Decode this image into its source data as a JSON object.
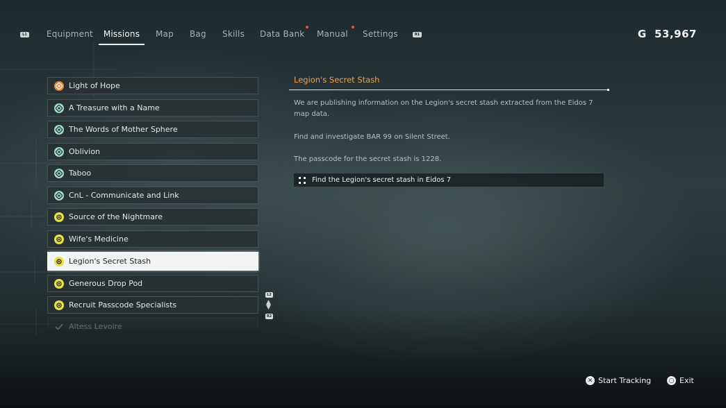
{
  "header": {
    "left_bumper": "L1",
    "right_bumper": "R1",
    "tabs": [
      {
        "label": "Equipment"
      },
      {
        "label": "Missions"
      },
      {
        "label": "Map"
      },
      {
        "label": "Bag"
      },
      {
        "label": "Skills"
      },
      {
        "label": "Data Bank"
      },
      {
        "label": "Manual"
      },
      {
        "label": "Settings"
      }
    ],
    "active_tab": "Missions",
    "notification_color": "#e0553c",
    "currency_symbol": "G",
    "currency_amount": "53,967"
  },
  "missions": {
    "items": [
      {
        "label": "Light of Hope",
        "icon": "main-mission-icon"
      },
      {
        "label": "A Treasure with a Name",
        "icon": "side-mission-icon"
      },
      {
        "label": "The Words of Mother Sphere",
        "icon": "side-mission-icon"
      },
      {
        "label": "Oblivion",
        "icon": "side-mission-icon"
      },
      {
        "label": "Taboo",
        "icon": "side-mission-icon"
      },
      {
        "label": "CnL - Communicate and Link",
        "icon": "side-mission-icon"
      },
      {
        "label": "Source of the Nightmare",
        "icon": "request-mission-icon"
      },
      {
        "label": "Wife's Medicine",
        "icon": "request-mission-icon"
      },
      {
        "label": "Legion's Secret Stash",
        "icon": "request-mission-icon"
      },
      {
        "label": "Generous Drop Pod",
        "icon": "request-mission-icon"
      },
      {
        "label": "Recruit Passcode Specialists",
        "icon": "request-mission-icon"
      },
      {
        "label": "Altess Levoire",
        "icon": "completed-check-icon"
      }
    ],
    "selected": "Legion's Secret Stash",
    "scroll_up_button": "L2",
    "scroll_down_button": "R2"
  },
  "detail": {
    "title": "Legion's Secret Stash",
    "paragraphs": [
      "We are publishing information on the Legion's secret stash extracted from the Eidos 7 map data.",
      "Find and investigate BAR 99 on Silent Street.",
      "The passcode for the secret stash is 1228."
    ],
    "objective": "Find the Legion's secret stash in Eidos 7",
    "accent_color": "#f0a04a"
  },
  "footer": {
    "start_tracking": {
      "button": "✕",
      "label": "Start Tracking"
    },
    "exit": {
      "button": "○",
      "label": "Exit"
    }
  }
}
